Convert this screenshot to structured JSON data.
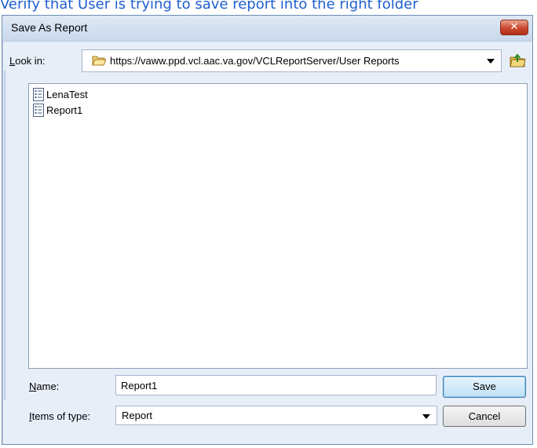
{
  "document": {
    "caption": "Verify that User is trying to save report into the right folder"
  },
  "dialog": {
    "title": "Save As Report",
    "close_glyph": "✕",
    "look_in": {
      "label_mnemonic": "L",
      "label_rest": "ook in:",
      "path": "https://vaww.ppd.vcl.aac.va.gov/VCLReportServer/User Reports",
      "folder_icon": "folder-open-icon"
    },
    "up_folder_icon": "up-one-level-folder-icon",
    "files": [
      {
        "name": "LenaTest",
        "icon": "report-file-icon"
      },
      {
        "name": "Report1",
        "icon": "report-file-icon"
      }
    ],
    "name_field": {
      "label_mnemonic": "N",
      "label_rest": "ame:",
      "value": "Report1"
    },
    "items_of_type": {
      "label_mnemonic": "I",
      "label_rest": "tems of type:",
      "selected": "Report"
    },
    "buttons": {
      "save": "Save",
      "cancel": "Cancel"
    }
  },
  "colors": {
    "caption_text": "#1f5fd0",
    "dialog_bg": "#e7eef8",
    "close_button": "#c9472d",
    "save_button_border": "#3c7fb1"
  }
}
